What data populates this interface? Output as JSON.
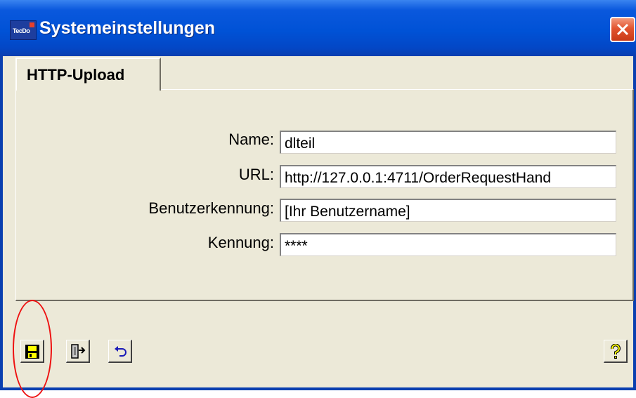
{
  "window": {
    "title": "Systemeinstellungen",
    "app_icon_text": "TecDo",
    "close_icon": "close-x-icon",
    "colors": {
      "titlebar": "#0052d6",
      "close_button": "#e2542f",
      "face": "#ece9d8",
      "highlight_ellipse": "#ee1111"
    }
  },
  "tabs": [
    {
      "label": "HTTP-Upload",
      "selected": true
    }
  ],
  "form": {
    "name": {
      "label": "Name:",
      "value": "dlteil"
    },
    "url": {
      "label": "URL:",
      "value": "http://127.0.0.1:4711/OrderRequestHand"
    },
    "benutzerkennung": {
      "label": "Benutzerkennung:",
      "value": "[Ihr Benutzername]"
    },
    "kennung": {
      "label": "Kennung:",
      "value": "****"
    }
  },
  "toolbar": {
    "save": {
      "icon": "save-disk-icon"
    },
    "exit": {
      "icon": "exit-door-icon"
    },
    "undo": {
      "icon": "undo-arrow-icon"
    },
    "help": {
      "icon": "help-question-icon"
    }
  }
}
